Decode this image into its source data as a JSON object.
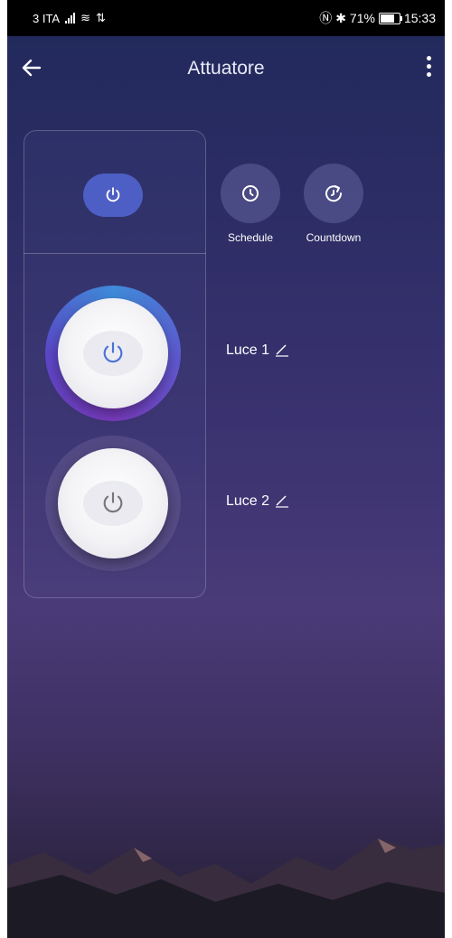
{
  "statusbar": {
    "carrier": "3 ITA",
    "battery": "71%",
    "time": "15:33"
  },
  "appbar": {
    "title": "Attuatore"
  },
  "actions": {
    "schedule_label": "Schedule",
    "countdown_label": "Countdown"
  },
  "channels": [
    {
      "label": "Luce 1",
      "state": "on"
    },
    {
      "label": "Luce 2",
      "state": "off"
    }
  ],
  "colors": {
    "accent": "#4d5fc4",
    "background_top": "#20295a",
    "background_bottom": "#241f33"
  }
}
